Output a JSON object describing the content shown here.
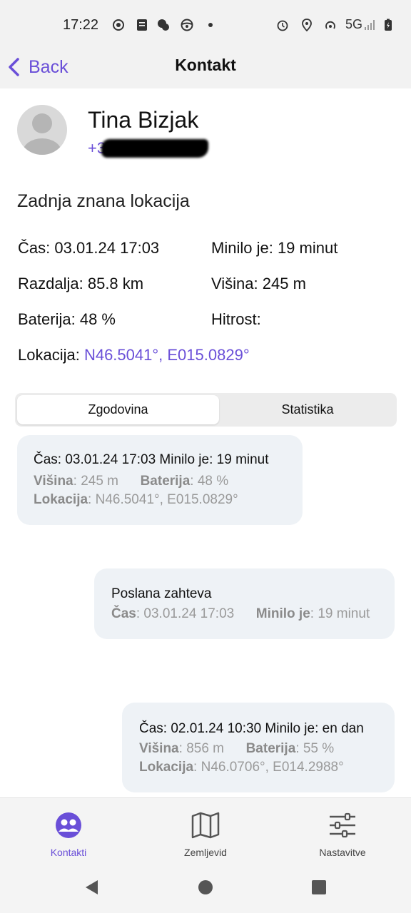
{
  "status_bar": {
    "time": "17:22",
    "network": "5G"
  },
  "header": {
    "back_label": "Back",
    "title": "Kontakt"
  },
  "contact": {
    "name": "Tina Bizjak",
    "phone_visible": "+3"
  },
  "last_location": {
    "section_title": "Zadnja znana lokacija",
    "time_label": "Čas",
    "time_value": "03.01.24 17:03",
    "elapsed_label": "Minilo je",
    "elapsed_value": "19 minut",
    "distance_label": "Razdalja",
    "distance_value": "85.8 km",
    "altitude_label": "Višina",
    "altitude_value": "245 m",
    "battery_label": "Baterija",
    "battery_value": "48 %",
    "speed_label": "Hitrost",
    "speed_value": "",
    "location_label": "Lokacija",
    "location_value": "N46.5041°, E015.0829°"
  },
  "tabs": {
    "history": "Zgodovina",
    "stats": "Statistika"
  },
  "history": [
    {
      "main": "Čas: 03.01.24 17:03 Minilo je: 19 minut",
      "altitude_label": "Višina",
      "altitude_value": "245 m",
      "battery_label": "Baterija",
      "battery_value": "48 %",
      "location_label": "Lokacija",
      "location_value": "N46.5041°, E015.0829°"
    },
    {
      "title": "Poslana zahteva",
      "time_label": "Čas",
      "time_value": "03.01.24 17:03",
      "elapsed_label": "Minilo je",
      "elapsed_value": "19 minut"
    },
    {
      "main": "Čas: 02.01.24 10:30 Minilo je: en dan",
      "altitude_label": "Višina",
      "altitude_value": "856 m",
      "battery_label": "Baterija",
      "battery_value": "55 %",
      "location_label": "Lokacija",
      "location_value": "N46.0706°, E014.2988°"
    }
  ],
  "bottom_nav": {
    "contacts": "Kontakti",
    "map": "Zemljevid",
    "settings": "Nastavitve"
  },
  "colors": {
    "accent": "#6a4fd8",
    "bubble": "#eef2f6"
  }
}
